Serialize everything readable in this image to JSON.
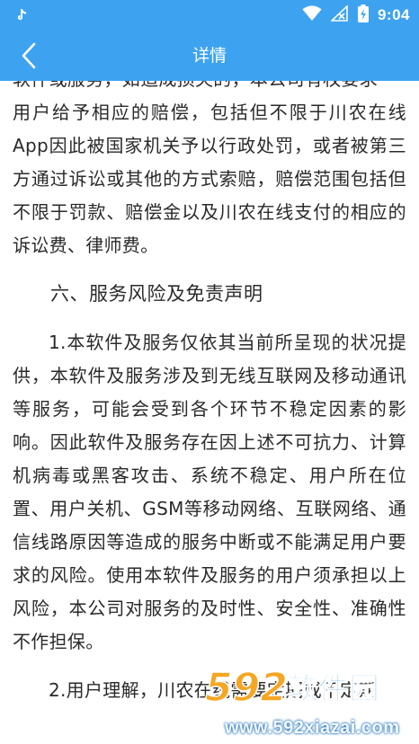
{
  "status_bar": {
    "time": "9:04",
    "icons": [
      "tiktok-icon",
      "wifi-icon",
      "no-signal-icon",
      "battery-charging-icon"
    ]
  },
  "header": {
    "title": "详情",
    "back_icon": "chevron-left-icon"
  },
  "colors": {
    "accent": "#3da3f0",
    "text": "#2a2a2a",
    "background": "#ffffff"
  },
  "content": {
    "top_partial": "软件或服务，如造成损失的，本公司有权要求",
    "para1_rest": "用户给予相应的赔偿，包括但不限于川农在线App因此被国家机关予以行政处罚，或者被第三方通过诉讼或其他的方式索赔，赔偿范围包括但不限于罚款、赔偿金以及川农在线支付的相应的诉讼费、律师费。",
    "section_heading": "六、服务风险及免责声明",
    "para2": "1.本软件及服务仅依其当前所呈现的状况提供，本软件及服务涉及到无线互联网及移动通讯等服务，可能会受到各个环节不稳定因素的影响。因此软件及服务存在因上述不可抗力、计算机病毒或黑客攻击、系统不稳定、用户所在位置、用户关机、GSM等移动网络、互联网络、通信线路原因等造成的服务中断或不能满足用户要求的风险。使用本软件及服务的用户须承担以上风险，本公司对服务的及时性、安全性、准确性不作担保。",
    "para3_partial": "2.用户理解，川农在线需要定期或不定期"
  },
  "watermark": {
    "logo_text": "592软件园",
    "url": "www.592xiazai.com"
  }
}
